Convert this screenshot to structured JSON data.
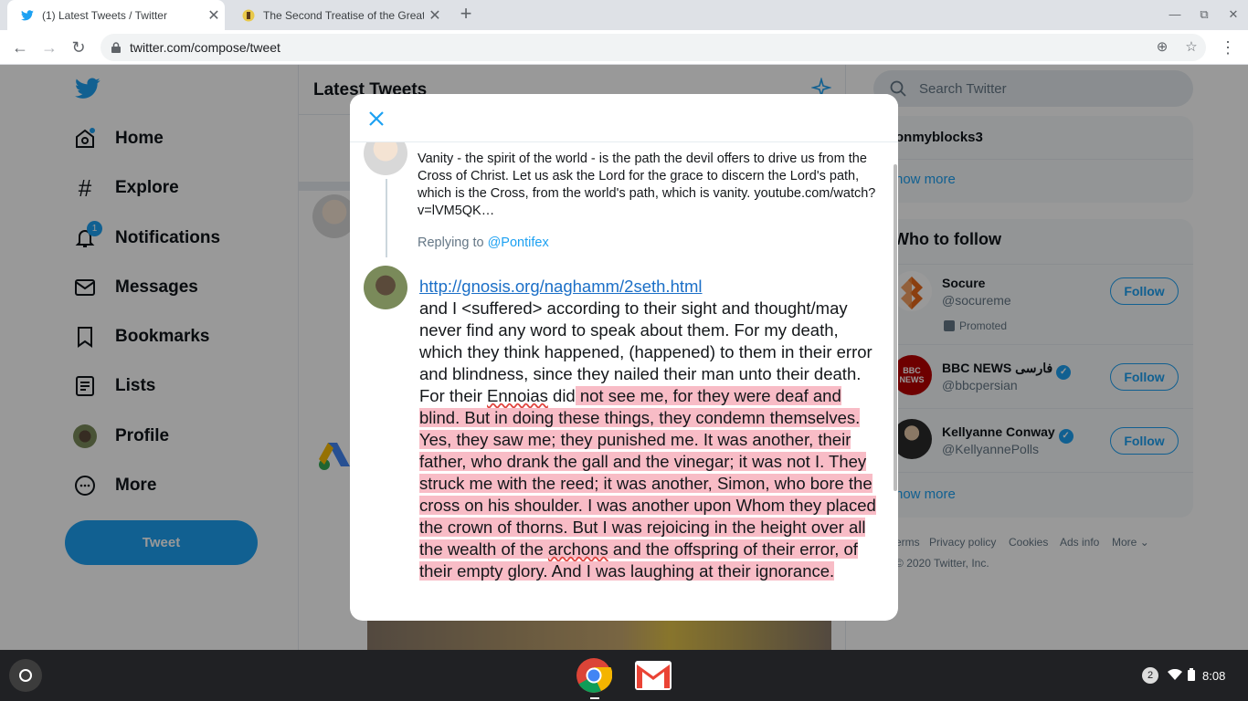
{
  "browser": {
    "tabs": [
      {
        "title": "(1) Latest Tweets / Twitter",
        "active": true
      },
      {
        "title": "The Second Treatise of the Great",
        "active": false
      }
    ],
    "url": "twitter.com/compose/tweet"
  },
  "nav": {
    "items": [
      {
        "label": "Home"
      },
      {
        "label": "Explore"
      },
      {
        "label": "Notifications",
        "badge": "1"
      },
      {
        "label": "Messages"
      },
      {
        "label": "Bookmarks"
      },
      {
        "label": "Lists"
      },
      {
        "label": "Profile"
      },
      {
        "label": "More"
      }
    ],
    "tweet_button": "Tweet"
  },
  "timeline": {
    "title": "Latest Tweets"
  },
  "right": {
    "search_placeholder": "Search Twitter",
    "trend_fragment": "onmyblocks3",
    "show_more_1": "how more",
    "who_to_follow": "Who to follow",
    "accounts": [
      {
        "name": "Socure",
        "handle": "@socureme",
        "promoted": "Promoted",
        "button": "Follow"
      },
      {
        "name": "BBC NEWS فارسی",
        "handle": "@bbcpersian",
        "button": "Follow"
      },
      {
        "name": "Kellyanne Conway",
        "handle": "@KellyannePolls",
        "button": "Follow"
      }
    ],
    "show_more_2": "how more",
    "footer": [
      "erms",
      "Privacy policy",
      "Cookies",
      "Ads info",
      "More"
    ],
    "copyright": "2020 Twitter, Inc."
  },
  "modal": {
    "original_tweet": "Vanity - the spirit of the world - is the path the devil offers to drive us from the Cross of Christ. Let us ask the Lord for the grace to discern the Lord's path, which is the Cross, from the world's path, which is vanity. youtube.com/watch?v=lVM5QK…",
    "replying_prefix": "Replying to",
    "replying_handle": "@Pontifex",
    "compose_link": "http://gnosis.org/naghamm/2seth.html",
    "compose_text_a": "and I <suffered> according to their sight and thought/may never find any word to speak about them. For my death, which they think happened, (happened) to them in their error and blindness, since they nailed their man unto their death. For their ",
    "compose_ennoias": "Ennoias",
    "compose_text_b": " did",
    "compose_highlight_1": " not see me, for they were deaf and blind. But in doing these things, they condemn themselves. Yes, they saw me; they punished me. It was another, their father, who drank the gall and the vinegar; it was not I. They struck me with the reed; it was another, Simon, who bore the cross on his shoulder. I was another upon Whom they placed the crown of thorns. But I was rejoicing in the height over all the wealth of the ",
    "compose_archons": "archons",
    "compose_highlight_2": " and the offspring of their error, of their empty glory. And I was laughing at their ignorance."
  },
  "shelf": {
    "notification_count": "2",
    "time": "8:08"
  }
}
